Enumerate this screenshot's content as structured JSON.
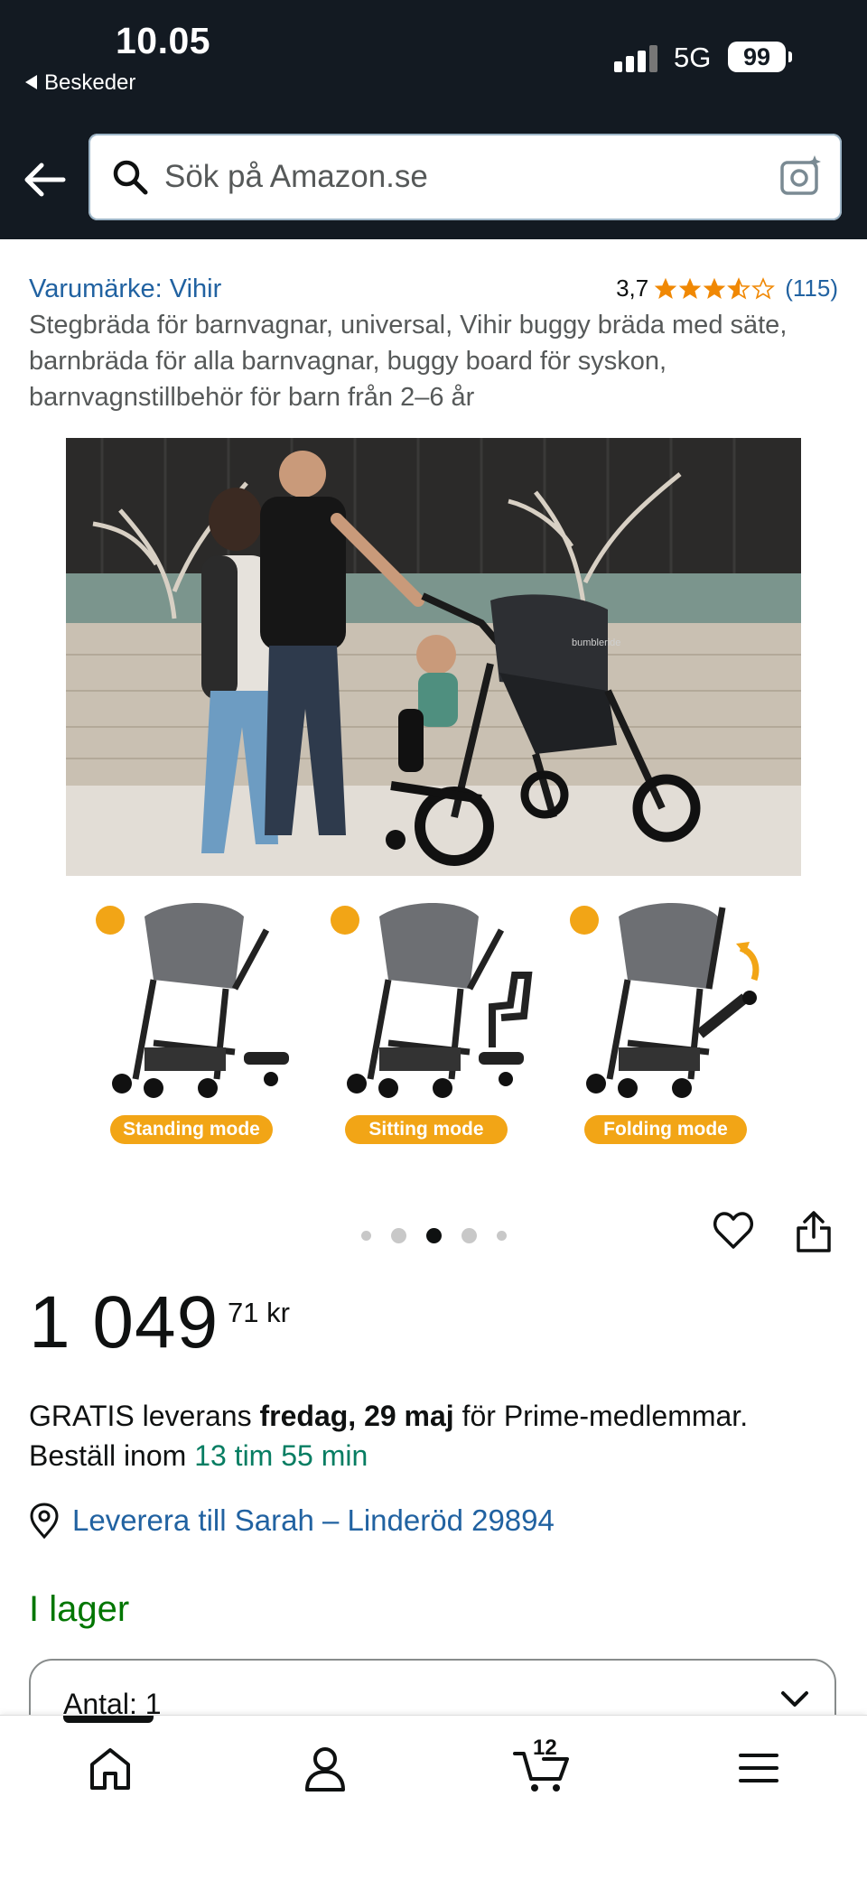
{
  "status_bar": {
    "time": "10.05",
    "back_app": "Beskeder",
    "network": "5G",
    "battery": "99"
  },
  "search": {
    "placeholder": "Sök på Amazon.se"
  },
  "product": {
    "brand": "Varumärke: Vihir",
    "rating_value": "3,7",
    "rating_stars": 3.7,
    "rating_count": "(115)",
    "title": "Stegbräda för barnvagnar, universal, Vihir buggy bräda med säte, barnbräda för alla barnvagnar, buggy board för syskon, barnvagnstillbehör för barn från 2–6 år",
    "image_text": {
      "stroller_brand": "bumbleride",
      "modes": [
        "Standing mode",
        "Sitting mode",
        "Folding mode"
      ]
    },
    "carousel": {
      "count": 5,
      "active_index": 2
    },
    "price_whole": "1 049",
    "price_fraction": "71 kr"
  },
  "delivery": {
    "prefix": "GRATIS leverans ",
    "date": "fredag, 29 maj",
    "suffix": " för Prime-medlemmar.",
    "order_within_label": "Beställ inom ",
    "order_within_time": "13 tim 55 min",
    "deliver_to": "Leverera till Sarah – Linderöd 29894"
  },
  "stock": "I lager",
  "quantity": {
    "label": "Antal:",
    "value": "1"
  },
  "bottom_nav": {
    "items": [
      "home-icon",
      "account-icon",
      "cart-icon",
      "menu-icon"
    ],
    "cart_count": "12"
  },
  "colors": {
    "header_bg": "#131a22",
    "link": "#2162a1",
    "in_stock": "#007600",
    "star": "#f08804",
    "mode_accent": "#f2a516"
  }
}
